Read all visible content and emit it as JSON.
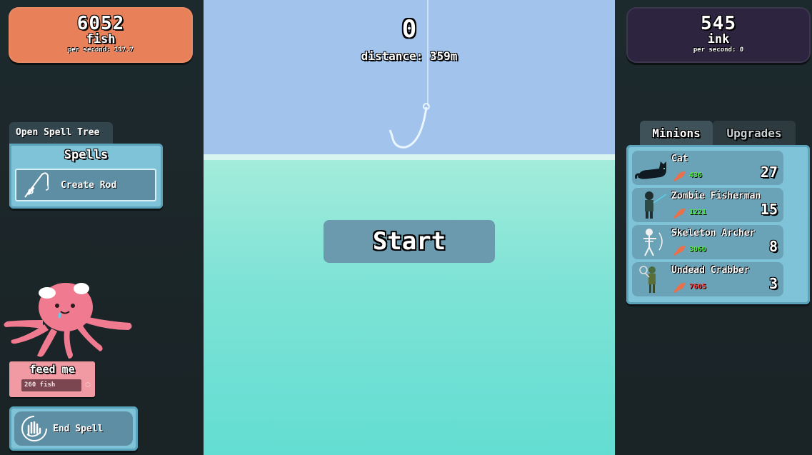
{
  "fish": {
    "amount": "6052",
    "unit": "fish",
    "rate": "per second: 117.7"
  },
  "ink": {
    "amount": "545",
    "unit": "ink",
    "rate": "per second: 0"
  },
  "spells": {
    "tree_tab": "Open Spell Tree",
    "title": "Spells",
    "items": [
      {
        "label": "Create Rod",
        "icon": "fishing-rod-icon"
      }
    ]
  },
  "feed": {
    "title": "feed me",
    "value": "260 fish"
  },
  "end_spell": {
    "label": "End Spell",
    "icon": "hand-swirl-icon"
  },
  "game": {
    "score": "0",
    "distance": "distance: 359m",
    "start_label": "Start"
  },
  "tabs": {
    "minions": "Minions",
    "upgrades": "Upgrades",
    "active": "Minions"
  },
  "minions": [
    {
      "name": "Cat",
      "cost": "436",
      "affordable": true,
      "count": "27",
      "icon": "cat-icon"
    },
    {
      "name": "Zombie Fisherman",
      "cost": "1221",
      "affordable": true,
      "count": "15",
      "icon": "zombie-fisherman-icon"
    },
    {
      "name": "Skeleton Archer",
      "cost": "3060",
      "affordable": true,
      "count": "8",
      "icon": "skeleton-archer-icon"
    },
    {
      "name": "Undead Crabber",
      "cost": "7605",
      "affordable": false,
      "count": "3",
      "icon": "undead-crabber-icon"
    }
  ],
  "colors": {
    "fish_panel": "#e8815a",
    "ink_panel": "#2d2540",
    "panel_blue": "#7fc3d8",
    "sky": "#a1c3ec",
    "water": "#7fe3d6",
    "affordable": "#4bf03c",
    "unaffordable": "#ff3a3a"
  }
}
